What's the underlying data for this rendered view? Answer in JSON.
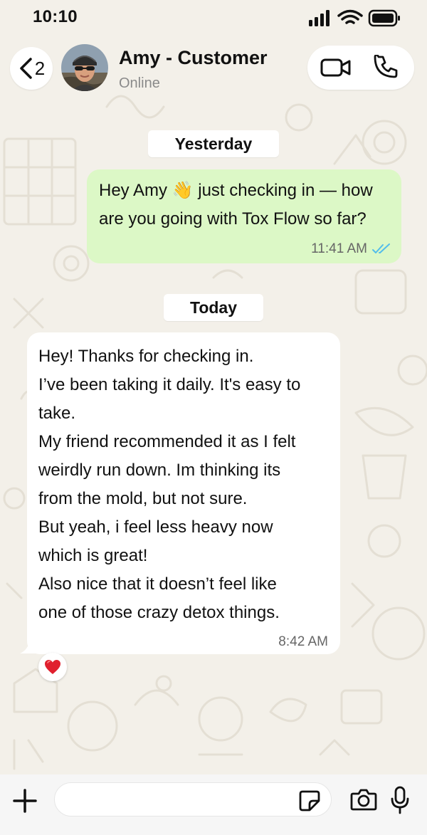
{
  "status_bar": {
    "time": "10:10"
  },
  "header": {
    "back_count": "2",
    "contact_name": "Amy - Customer",
    "contact_status": "Online"
  },
  "chat": {
    "date_yesterday": "Yesterday",
    "date_today": "Today",
    "outgoing": {
      "lines": [
        "Hey Amy 👋 just checking in — how",
        "are you going with Tox Flow so far?"
      ],
      "time": "11:41 AM"
    },
    "incoming": {
      "lines": [
        "Hey! Thanks for checking in.",
        "I’ve been taking it daily. It's easy to",
        "take.",
        "My friend recommended it as I felt",
        "weirdly run down. Im thinking its",
        "from the mold, but not sure.",
        "But yeah, i feel less heavy now",
        "which is great!",
        "Also nice that it doesn’t feel like",
        "one of those crazy detox things."
      ],
      "time": "8:42 AM",
      "reaction": "❤️"
    }
  },
  "composer": {
    "placeholder": ""
  },
  "colors": {
    "outgoing_bubble": "#dcf8c6",
    "incoming_bubble": "#ffffff",
    "wallpaper": "#f3f0e9",
    "read_ticks": "#53bdeb"
  },
  "icons": [
    "back-chevron-icon",
    "video-call-icon",
    "phone-icon",
    "double-check-icon",
    "plus-icon",
    "sticker-icon",
    "camera-icon",
    "microphone-icon"
  ]
}
